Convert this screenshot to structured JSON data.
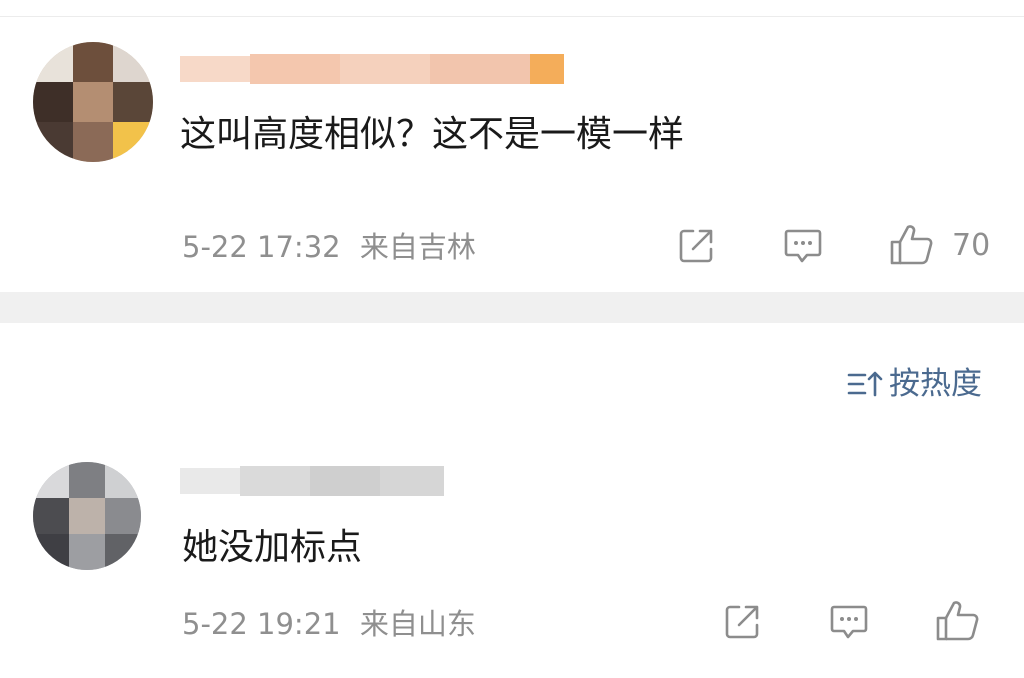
{
  "comments": [
    {
      "text": "这叫高度相似？这不是一模一样",
      "time": "5-22 17:32",
      "location": "来自吉林",
      "likes": "70"
    },
    {
      "text": "她没加标点",
      "time": "5-22 19:21",
      "location": "来自山东",
      "likes": ""
    }
  ],
  "sort": {
    "label": "按热度"
  },
  "icons": {
    "share": "share-icon",
    "reply": "comment-icon",
    "like": "thumbs-up-icon",
    "sort": "sort-icon"
  },
  "colors": {
    "link": "#4b6a8f",
    "meta": "#8f8f8f",
    "text": "#1a1a1a",
    "divider": "#f0f0f0"
  }
}
